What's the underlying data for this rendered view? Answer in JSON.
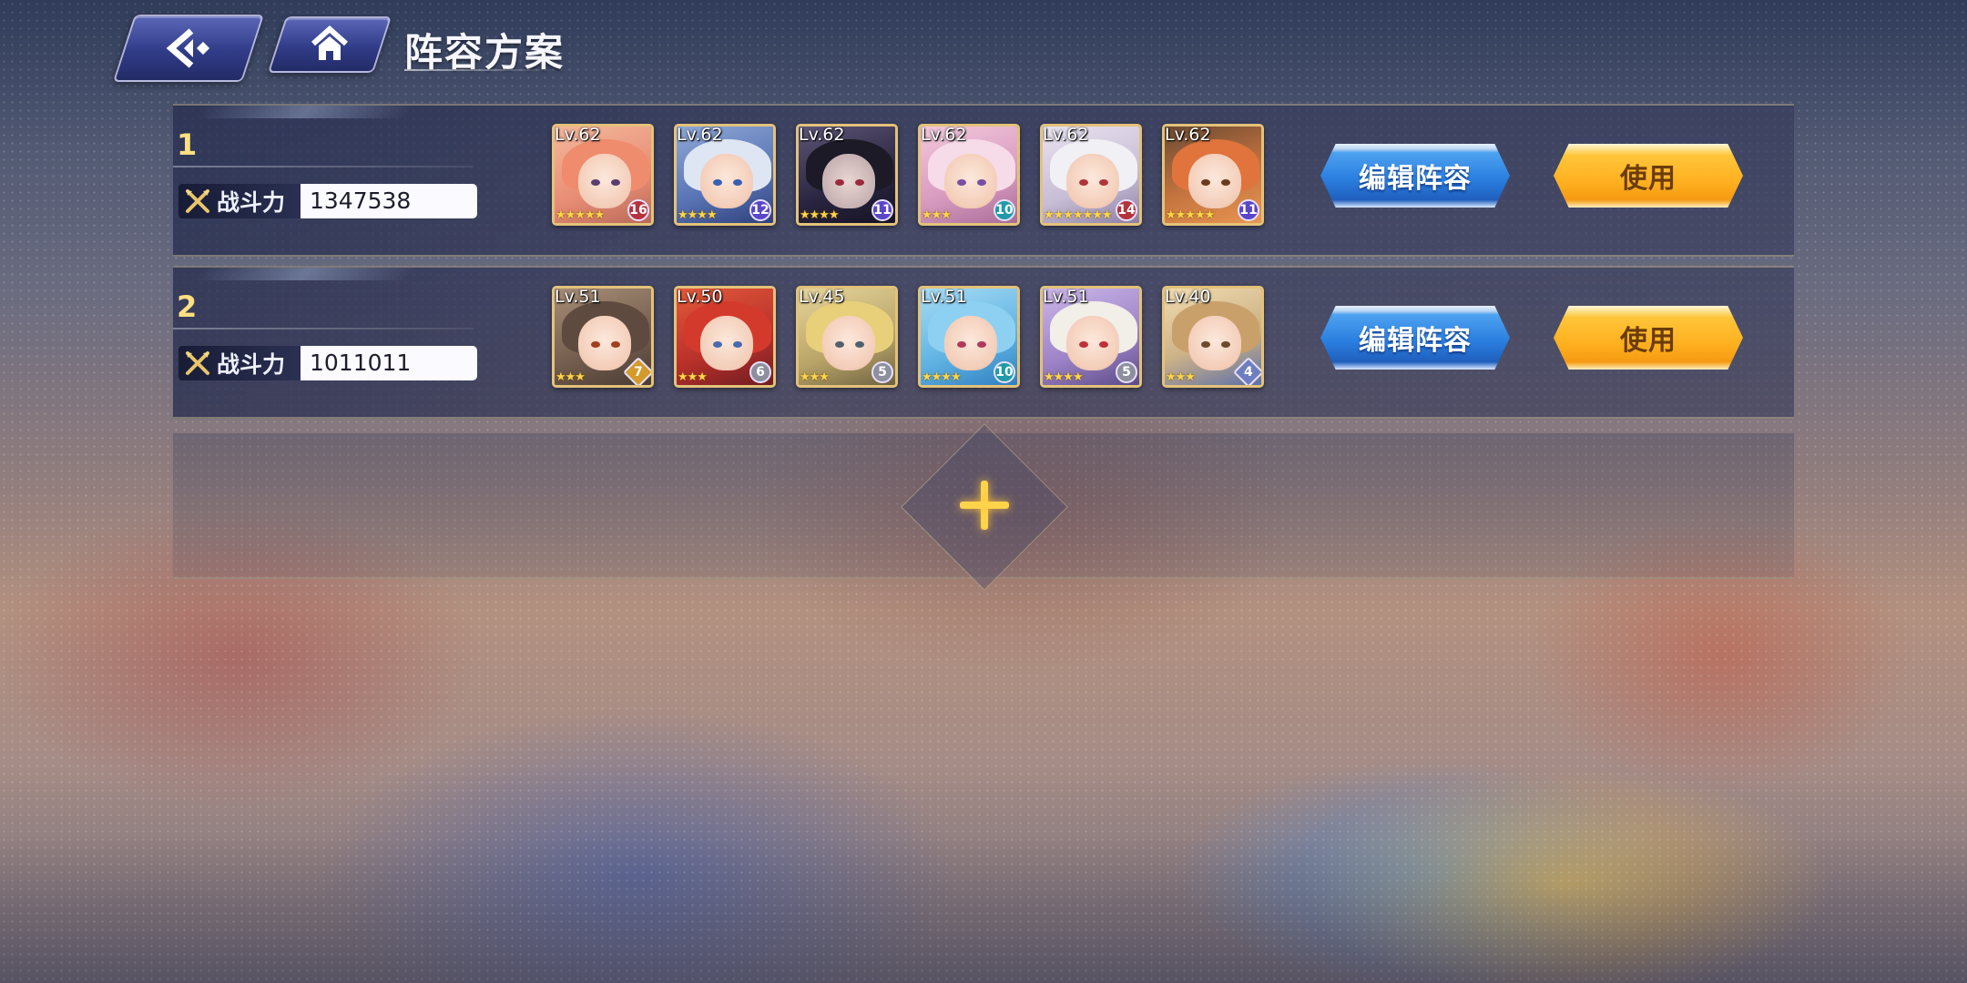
{
  "header": {
    "title": "阵容方案"
  },
  "lineups": [
    {
      "index": "1",
      "power_label": "战斗力",
      "power_value": "1347538",
      "edit_label": "编辑阵容",
      "use_label": "使用",
      "heroes": [
        {
          "level": "Lv.62",
          "stars": "★★★★★",
          "badge": "16"
        },
        {
          "level": "Lv.62",
          "stars": "★★★★",
          "badge": "12"
        },
        {
          "level": "Lv.62",
          "stars": "★★★★",
          "badge": "11"
        },
        {
          "level": "Lv.62",
          "stars": "★★★",
          "badge": "10"
        },
        {
          "level": "Lv.62",
          "stars": "★★★★★★★",
          "badge": "14"
        },
        {
          "level": "Lv.62",
          "stars": "★★★★★",
          "badge": "11"
        }
      ]
    },
    {
      "index": "2",
      "power_label": "战斗力",
      "power_value": "1011011",
      "edit_label": "编辑阵容",
      "use_label": "使用",
      "heroes": [
        {
          "level": "Lv.51",
          "stars": "★★★",
          "badge": "7"
        },
        {
          "level": "Lv.50",
          "stars": "★★★",
          "badge": "6"
        },
        {
          "level": "Lv.45",
          "stars": "★★★",
          "badge": "5"
        },
        {
          "level": "Lv.51",
          "stars": "★★★★",
          "badge": "10"
        },
        {
          "level": "Lv.51",
          "stars": "★★★★",
          "badge": "5"
        },
        {
          "level": "Lv.40",
          "stars": "★★★",
          "badge": "4"
        }
      ]
    }
  ],
  "icons": {
    "back": "back-arrow-icon",
    "home": "home-icon",
    "power": "crossed-swords-icon",
    "add": "plus-icon"
  },
  "colors": {
    "accent_gold": "#ffd34a",
    "edit_blue": "#2b7fe0",
    "use_yellow": "#ffb020",
    "frame_gold": "#e3c27a"
  }
}
